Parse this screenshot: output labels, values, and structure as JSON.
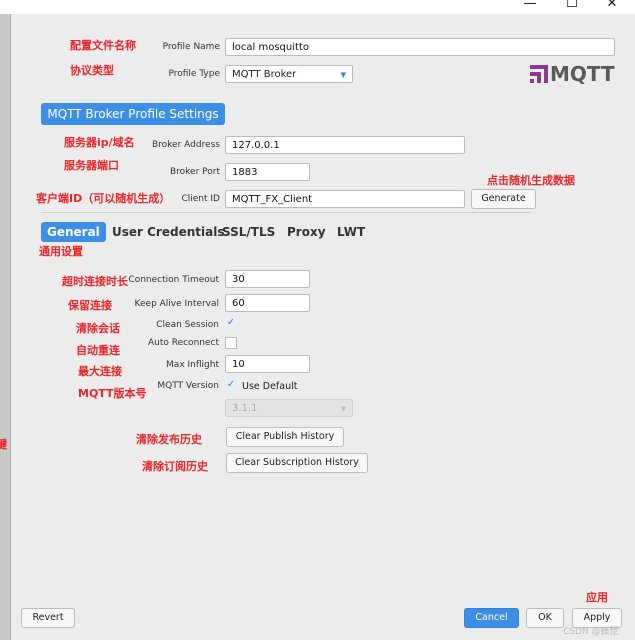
{
  "window": {
    "minimize_icon": "—",
    "maximize_icon": "☐",
    "close_icon": "✕"
  },
  "profile": {
    "name_label": "Profile Name",
    "name_value": "local mosquitto",
    "type_label": "Profile Type",
    "type_value": "MQTT Broker",
    "logo_text": "MQTT"
  },
  "section_title": "MQTT Broker Profile Settings",
  "broker": {
    "address_label": "Broker Address",
    "address_value": "127.0.0.1",
    "port_label": "Broker Port",
    "port_value": "1883",
    "client_id_label": "Client ID",
    "client_id_value": "MQTT_FX_Client",
    "generate_label": "Generate"
  },
  "tabs": [
    "General",
    "User Credentials",
    "SSL/TLS",
    "Proxy",
    "LWT"
  ],
  "general": {
    "connection_timeout_label": "Connection Timeout",
    "connection_timeout_value": "30",
    "keep_alive_label": "Keep Alive Interval",
    "keep_alive_value": "60",
    "clean_session_label": "Clean Session",
    "clean_session_checked": true,
    "auto_reconnect_label": "Auto Reconnect",
    "auto_reconnect_checked": false,
    "max_inflight_label": "Max Inflight",
    "max_inflight_value": "10",
    "mqtt_version_label": "MQTT Version",
    "use_default_label": "Use Default",
    "use_default_checked": true,
    "version_value": "3.1.1",
    "clear_publish_label": "Clear Publish History",
    "clear_subscription_label": "Clear Subscription History"
  },
  "footer": {
    "revert": "Revert",
    "cancel": "Cancel",
    "ok": "OK",
    "apply": "Apply"
  },
  "annotations": {
    "profile_name": "配置文件名称",
    "protocol_type": "协议类型",
    "server_ip": "服务器ip/域名",
    "server_port": "服务器端口",
    "client_id": "客户端ID（可以随机生成）",
    "random_generate": "点击随机生成数据",
    "general_settings": "通用设置",
    "timeout": "超时连接时长",
    "keep_alive": "保留连接",
    "clean_session": "清除会话",
    "auto_reconnect": "自动重连",
    "max_connections": "最大连接",
    "mqtt_version": "MQTT版本号",
    "clear_publish": "清除发布历史",
    "clear_subscription": "清除订阅历史",
    "apply": "应用",
    "left_edge": "键"
  },
  "watermark": "CSDN @蜂琵",
  "colors": {
    "accent": "#3d8fe6",
    "annotation": "#e8262c"
  }
}
